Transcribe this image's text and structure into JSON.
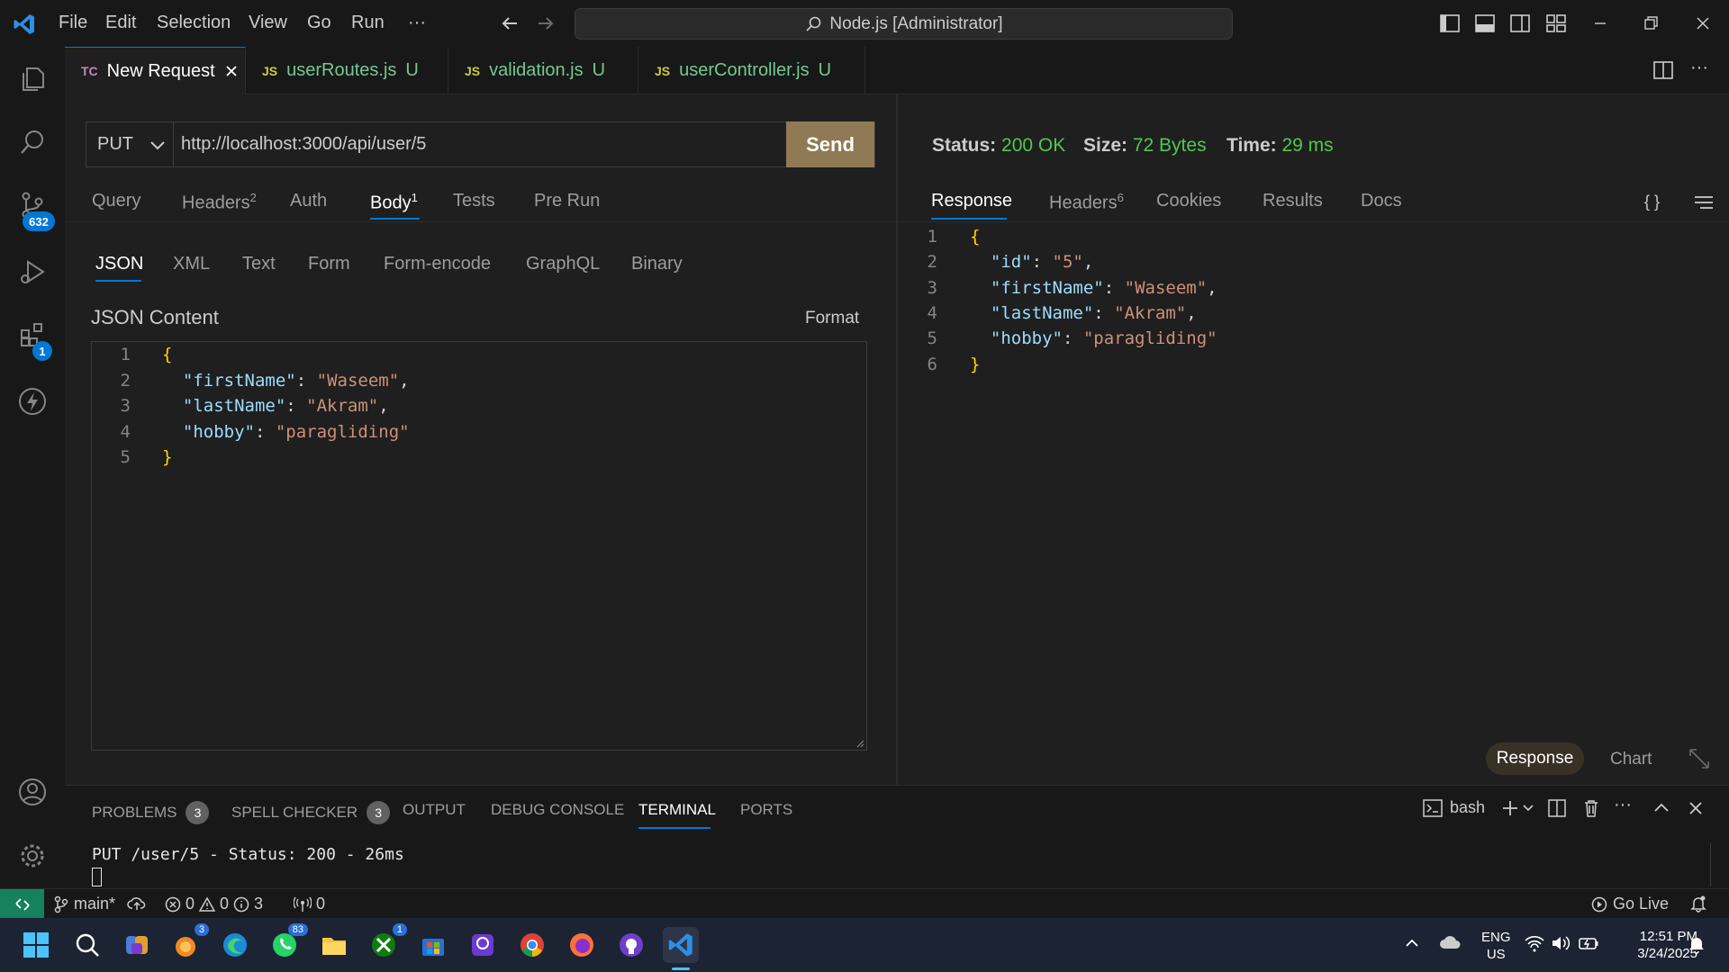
{
  "window": {
    "menu": [
      "File",
      "Edit",
      "Selection",
      "View",
      "Go",
      "Run",
      "···"
    ],
    "search_title": "Node.js [Administrator]"
  },
  "activity": {
    "source_control_badge": "632",
    "extensions_badge": "1"
  },
  "tabs": [
    {
      "icon": "TC",
      "label": "New Request",
      "suffix": "",
      "active": true
    },
    {
      "icon": "JS",
      "label": "userRoutes.js",
      "suffix": "U"
    },
    {
      "icon": "JS",
      "label": "validation.js",
      "suffix": "U"
    },
    {
      "icon": "JS",
      "label": "userController.js",
      "suffix": "U"
    }
  ],
  "request": {
    "method": "PUT",
    "url": "http://localhost:3000/api/user/5",
    "send_label": "Send",
    "tabs": {
      "query": "Query",
      "headers": "Headers",
      "headers_count": "2",
      "auth": "Auth",
      "body": "Body",
      "body_count": "1",
      "tests": "Tests",
      "prerun": "Pre Run"
    },
    "body_tabs": [
      "JSON",
      "XML",
      "Text",
      "Form",
      "Form-encode",
      "GraphQL",
      "Binary"
    ],
    "json_label": "JSON Content",
    "format_label": "Format",
    "lines": [
      {
        "n": "1",
        "pre": "{",
        "key": "",
        "val": "",
        "post": ""
      },
      {
        "n": "2",
        "pre": "  ",
        "key": "\"firstName\"",
        "val": "\"Waseem\"",
        "post": ","
      },
      {
        "n": "3",
        "pre": "  ",
        "key": "\"lastName\"",
        "val": "\"Akram\"",
        "post": ","
      },
      {
        "n": "4",
        "pre": "  ",
        "key": "\"hobby\"",
        "val": "\"paragliding\"",
        "post": ""
      },
      {
        "n": "5",
        "pre": "}",
        "key": "",
        "val": "",
        "post": ""
      }
    ]
  },
  "response": {
    "status_label": "Status:",
    "status_value": "200 OK",
    "size_label": "Size:",
    "size_value": "72 Bytes",
    "time_label": "Time:",
    "time_value": "29 ms",
    "tabs": {
      "response": "Response",
      "headers": "Headers",
      "headers_count": "6",
      "cookies": "Cookies",
      "results": "Results",
      "docs": "Docs"
    },
    "braces_label": "{ }",
    "lines": [
      {
        "n": "1",
        "pre": "{",
        "key": "",
        "val": "",
        "post": ""
      },
      {
        "n": "2",
        "pre": "  ",
        "key": "\"id\"",
        "val": "\"5\"",
        "post": ","
      },
      {
        "n": "3",
        "pre": "  ",
        "key": "\"firstName\"",
        "val": "\"Waseem\"",
        "post": ","
      },
      {
        "n": "4",
        "pre": "  ",
        "key": "\"lastName\"",
        "val": "\"Akram\"",
        "post": ","
      },
      {
        "n": "5",
        "pre": "  ",
        "key": "\"hobby\"",
        "val": "\"paragliding\"",
        "post": ""
      },
      {
        "n": "6",
        "pre": "}",
        "key": "",
        "val": "",
        "post": ""
      }
    ],
    "view_response": "Response",
    "view_chart": "Chart"
  },
  "panel": {
    "tabs": {
      "problems": "PROBLEMS",
      "problems_count": "3",
      "spell": "SPELL CHECKER",
      "spell_count": "3",
      "output": "OUTPUT",
      "debug": "DEBUG CONSOLE",
      "terminal": "TERMINAL",
      "ports": "PORTS"
    },
    "shell": "bash",
    "terminal_line": "PUT /user/5 - Status: 200 - 26ms"
  },
  "statusbar": {
    "branch": "main*",
    "errors": "0",
    "warnings": "0",
    "infos": "3",
    "ports": "0",
    "go_live": "Go Live"
  },
  "taskbar": {
    "badges": {
      "app3": "3",
      "whatsapp": "83",
      "xbox": "1"
    },
    "lang": "ENG",
    "region": "US",
    "time": "12:51 PM",
    "date": "3/24/2025"
  },
  "colors": {
    "accent": "#0078d4",
    "send": "#8f7a55",
    "success": "#4ec94e",
    "remote": "#16825d"
  }
}
